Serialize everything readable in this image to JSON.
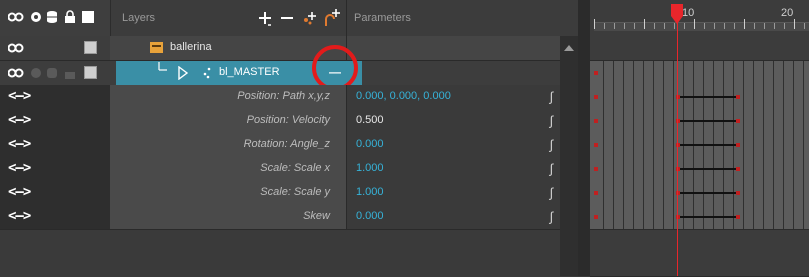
{
  "header": {
    "layers_label": "Layers",
    "parameters_label": "Parameters",
    "icons": [
      "animate-mode-icon",
      "visibility-icon",
      "lock-icon",
      "color-swatch-icon"
    ],
    "toolbar_icons": [
      "add-layer-icon",
      "remove-layer-icon",
      "add-peg-icon",
      "add-parent-peg-icon"
    ]
  },
  "timeline": {
    "frame_labels": [
      "10",
      "20"
    ],
    "current_frame": 10,
    "accent": "#e8262b"
  },
  "layers": [
    {
      "name": "ballerina",
      "type": "group"
    },
    {
      "name": "bl_MASTER",
      "type": "peg",
      "selected": true,
      "collapse_label": "—"
    }
  ],
  "parameters": [
    {
      "name": "Position: Path x,y,z",
      "value": "0.000, 0.000, 0.000",
      "value_color": "#36b3d9"
    },
    {
      "name": "Position: Velocity",
      "value": "0.500",
      "value_color": "#e8e8e8"
    },
    {
      "name": "Rotation: Angle_z",
      "value": "0.000",
      "value_color": "#36b3d9"
    },
    {
      "name": "Scale: Scale x",
      "value": "1.000",
      "value_color": "#36b3d9"
    },
    {
      "name": "Scale: Scale y",
      "value": "1.000",
      "value_color": "#36b3d9"
    },
    {
      "name": "Skew",
      "value": "0.000",
      "value_color": "#36b3d9"
    }
  ],
  "arrow_label": "<—>",
  "colors": {
    "selected_row": "#3a8fa6",
    "highlight_circle": "#e21b1b",
    "param_value": "#36b3d9"
  }
}
